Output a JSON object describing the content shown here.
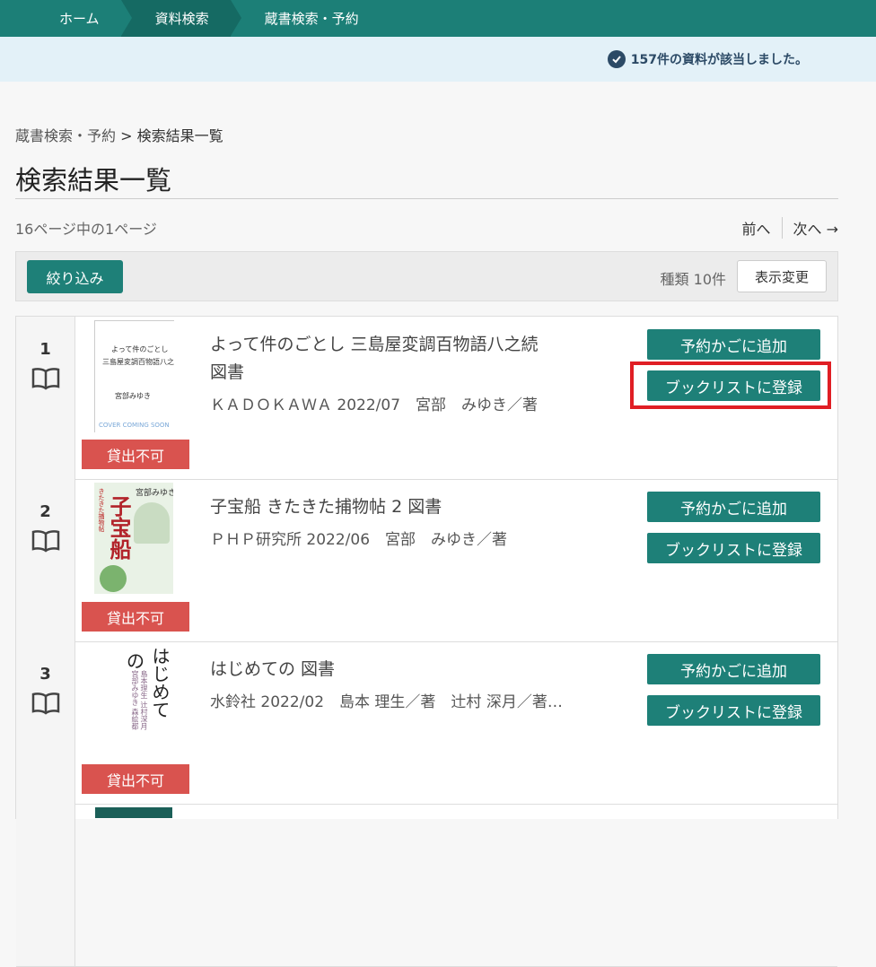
{
  "topnav": {
    "items": [
      {
        "label": "ホーム"
      },
      {
        "label": "資料検索"
      },
      {
        "label": "蔵書検索・予約"
      }
    ]
  },
  "notice": {
    "text": "157件の資料が該当しました。"
  },
  "breadcrumb": {
    "parent": "蔵書検索・予約",
    "separator": ">",
    "current": "検索結果一覧"
  },
  "page_title": "検索結果一覧",
  "paging": {
    "info": "16ページ中の1ページ",
    "prev": "前へ",
    "next": "次へ →"
  },
  "toolbar": {
    "filter_label": "絞り込み",
    "type_count": "種類 10件",
    "display_label": "表示変更"
  },
  "results": [
    {
      "num": "1",
      "title": "よって件のごとし 三島屋変調百物語八之続 図書",
      "meta": "ＫＡＤＯＫＡＷＡ 2022/07　宮部　みゆき／著",
      "badge": "貸出不可",
      "cover": {
        "line1": "よって件のごとし",
        "line2": "三島屋変調百物語八之続",
        "author": "宮部みゆき",
        "coming": "COVER COMING SOON"
      },
      "cart_label": "予約かごに追加",
      "list_label": "ブックリストに登録"
    },
    {
      "num": "2",
      "title": "子宝船 きたきた捕物帖 2 図書",
      "meta": "ＰＨＰ研究所 2022/06　宮部　みゆき／著",
      "badge": "貸出不可",
      "cover": {
        "author": "宮部みゆき",
        "title": "子宝船",
        "sub": "きたきた捕物帖"
      },
      "cart_label": "予約かごに追加",
      "list_label": "ブックリストに登録"
    },
    {
      "num": "3",
      "title": "はじめての 図書",
      "meta": "水鈴社 2022/02　島本 理生／著　辻村 深月／著…",
      "badge": "貸出不可",
      "cover": {
        "title": "はじめて",
        "title2": "の",
        "authors": "島本理生 辻村深月 宮部みゆき 森絵都"
      },
      "cart_label": "予約かごに追加",
      "list_label": "ブックリストに登録"
    }
  ],
  "colors": {
    "teal": "#1e8078",
    "badge_red": "#d9534f",
    "highlight": "#e01e24"
  }
}
